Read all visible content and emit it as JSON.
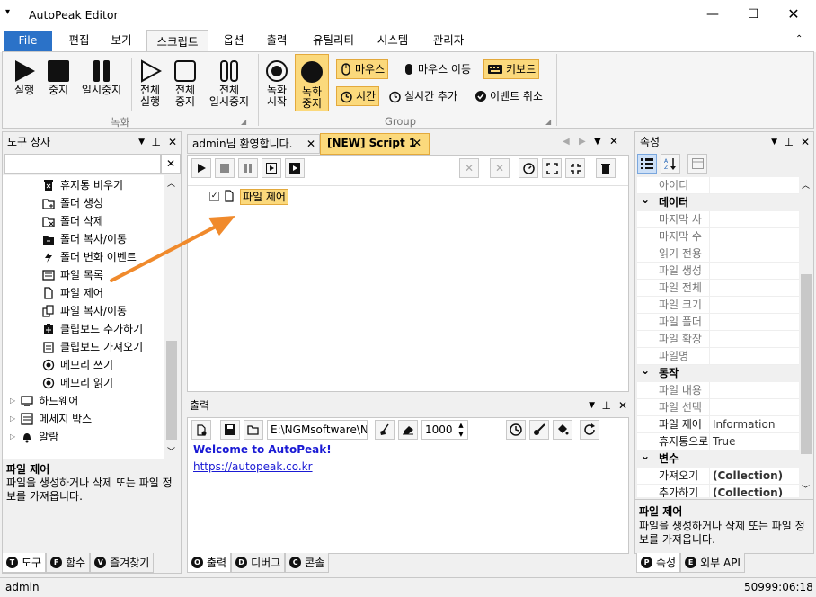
{
  "app": {
    "title": "AutoPeak Editor"
  },
  "menu": {
    "file": "File",
    "tabs": [
      "편집",
      "보기",
      "스크립트",
      "옵션",
      "출력",
      "유틸리티",
      "시스템",
      "관리자"
    ]
  },
  "ribbon": {
    "rec_group": {
      "run": "실행",
      "stop": "중지",
      "pause": "일시중지",
      "run_all_1": "전체",
      "run_all_2": "실행",
      "stop_all_1": "전체",
      "stop_all_2": "중지",
      "pause_all_1": "전체",
      "pause_all_2": "일시중지",
      "label": "녹화"
    },
    "group": {
      "rec_start_1": "녹화",
      "rec_start_2": "시작",
      "rec_stop_1": "녹화",
      "rec_stop_2": "중지",
      "mouse": "마우스",
      "mouse_move": "마우스 이동",
      "keyboard": "키보드",
      "time": "시간",
      "realtime_add": "실시간 추가",
      "cancel_event": "이벤트 취소",
      "label": "Group"
    }
  },
  "toolbox": {
    "title": "도구 상자",
    "search": "",
    "items": [
      "휴지통 비우기",
      "폴더 생성",
      "폴더 삭제",
      "폴더 복사/이동",
      "폴더 변화 이벤트",
      "파일 목록",
      "파일 제어",
      "파일 복사/이동",
      "클립보드 추가하기",
      "클립보드 가져오기",
      "메모리 쓰기",
      "메모리 읽기"
    ],
    "groups": [
      "하드웨어",
      "메세지 박스",
      "알람"
    ],
    "desc_title": "파일 제어",
    "desc_text": "파일을 생성하거나 삭제 또는 파일 정보를 가져옵니다.",
    "tabs": [
      "도구",
      "함수",
      "즐겨찾기"
    ],
    "tab_letters": [
      "T",
      "F",
      "V"
    ]
  },
  "editor": {
    "tabs": [
      "admin님 환영합니다.",
      "[NEW] Script 1"
    ],
    "node": "파일 제어"
  },
  "output": {
    "title": "출력",
    "path": "E:\\NGMsoftware\\NG",
    "count": "1000",
    "welcome": "Welcome to AutoPeak!",
    "link": "https://autopeak.co.kr",
    "tabs": [
      "출력",
      "디버그",
      "콘솔"
    ],
    "tab_letters": [
      "O",
      "D",
      "C"
    ]
  },
  "props": {
    "title": "속성",
    "rows": [
      {
        "k": "아이디",
        "v": "",
        "c": false
      },
      {
        "k": "데이터",
        "v": "",
        "c": true
      },
      {
        "k": "마지막 사",
        "v": "",
        "c": false
      },
      {
        "k": "마지막 수",
        "v": "",
        "c": false
      },
      {
        "k": "읽기 전용",
        "v": "",
        "c": false
      },
      {
        "k": "파일 생성",
        "v": "",
        "c": false
      },
      {
        "k": "파일 전체",
        "v": "",
        "c": false
      },
      {
        "k": "파일 크기",
        "v": "",
        "c": false
      },
      {
        "k": "파일 폴더",
        "v": "",
        "c": false
      },
      {
        "k": "파일 확장",
        "v": "",
        "c": false
      },
      {
        "k": "파일명",
        "v": "",
        "c": false
      },
      {
        "k": "동작",
        "v": "",
        "c": true
      },
      {
        "k": "파일 내용",
        "v": "",
        "c": false
      },
      {
        "k": "파일 선택",
        "v": "",
        "c": false
      },
      {
        "k": "파일 제어",
        "v": "Information",
        "c": false
      },
      {
        "k": "휴지통으로",
        "v": "True",
        "c": false
      },
      {
        "k": "변수",
        "v": "",
        "c": true
      },
      {
        "k": "가져오기",
        "v": "(Collection)",
        "c": false
      },
      {
        "k": "추가하기",
        "v": "(Collection)",
        "c": false
      }
    ],
    "desc_title": "파일 제어",
    "desc_text": "파일을 생성하거나 삭제 또는 파일 정보를 가져옵니다.",
    "tabs": [
      "속성",
      "외부 API"
    ],
    "tab_letters": [
      "P",
      "E"
    ]
  },
  "status": {
    "user": "admin",
    "time": "50999:06:18"
  },
  "colors": {
    "accent": "#2b72c8",
    "highlight": "#fbd97c",
    "arrow": "#f08a2c",
    "link": "#1a1ad4"
  }
}
